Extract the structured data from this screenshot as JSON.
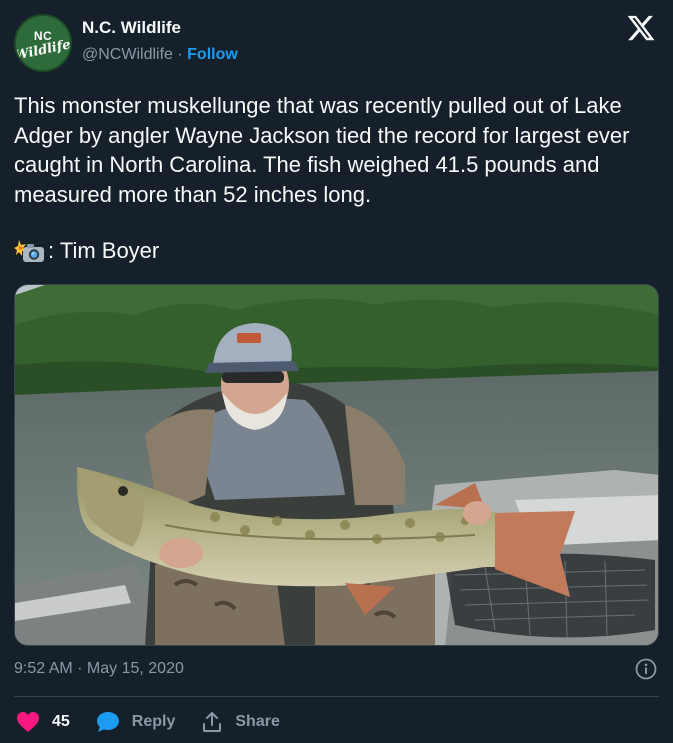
{
  "account": {
    "avatar_text_top": "NC",
    "avatar_text_bottom": "Wildlife",
    "name": "N.C. Wildlife",
    "handle": "@NCWildlife",
    "separator": " · ",
    "follow_label": "Follow"
  },
  "platform_icon": "x-logo-icon",
  "tweet": {
    "text": "This monster muskellunge that was recently pulled out of Lake Adger by angler Wayne Jackson tied the record for largest ever caught in North Carolina. The fish weighed 41.5 pounds and measured more than 52 inches long.",
    "credit_icon": "camera-flash-icon",
    "credit_text": ": Tim Boyer"
  },
  "media": {
    "icon": "photo-of-angler-with-muskellunge"
  },
  "meta": {
    "timestamp": "9:52 AM · May 15, 2020"
  },
  "actions": {
    "like_count": "45",
    "reply_label": "Reply",
    "share_label": "Share"
  },
  "colors": {
    "background": "#15202b",
    "accent": "#1d9bf0",
    "like": "#f91880",
    "muted": "#8b98a5"
  }
}
